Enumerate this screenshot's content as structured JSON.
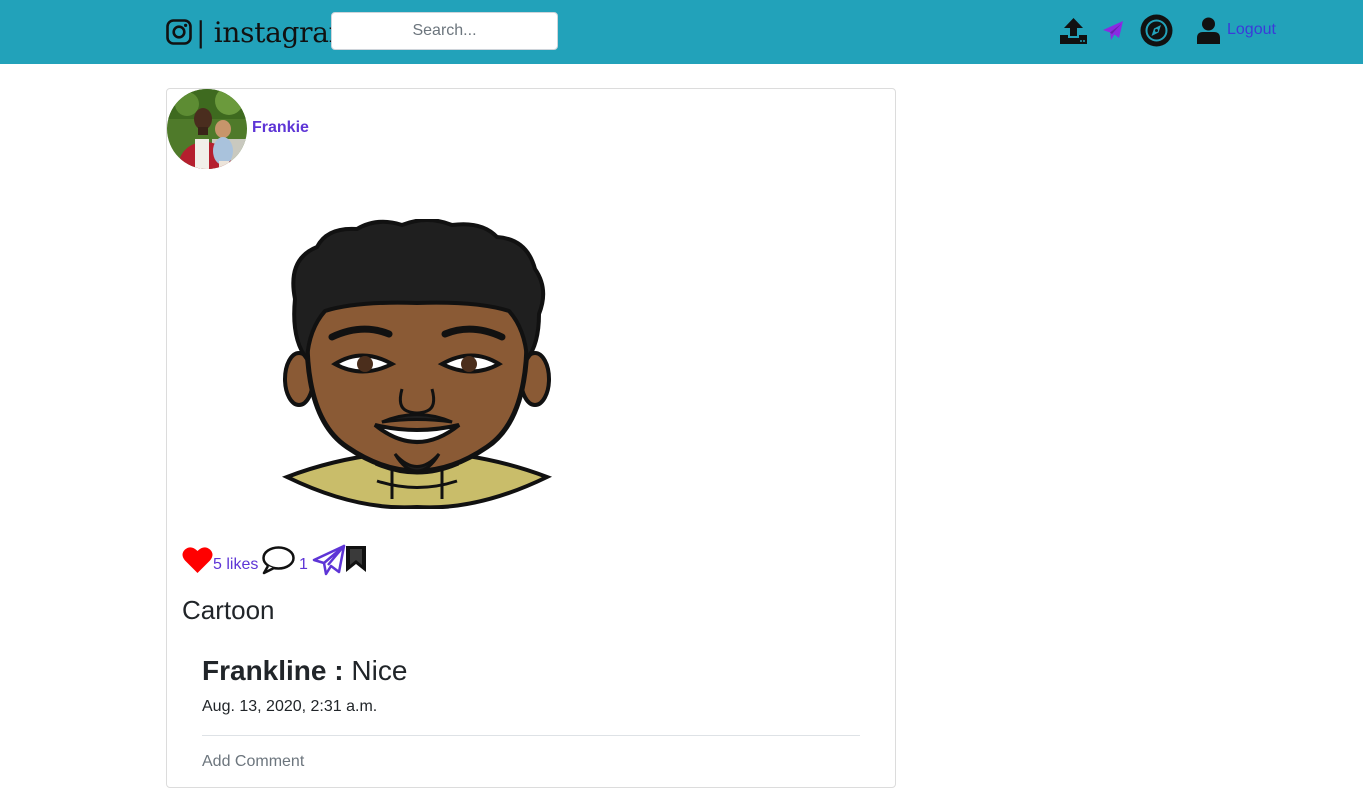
{
  "header": {
    "brand_text": "| instagram",
    "search_placeholder": "Search...",
    "logout_label": "Logout",
    "icons": [
      "instagram-icon",
      "upload-icon",
      "send-icon",
      "compass-icon",
      "user-icon"
    ]
  },
  "post": {
    "author": "Frankie",
    "likes_text": "5 likes",
    "comment_count": "1",
    "caption": "Cartoon",
    "comments": [
      {
        "user": "Frankline :",
        "text": " Nice",
        "date": "Aug. 13, 2020, 2:31 a.m."
      }
    ],
    "add_comment_placeholder": "Add Comment"
  },
  "colors": {
    "navbar": "#22a2ba",
    "link": "#5e35d6",
    "heart": "#ff0000",
    "send_nav": "#8a2be2"
  }
}
